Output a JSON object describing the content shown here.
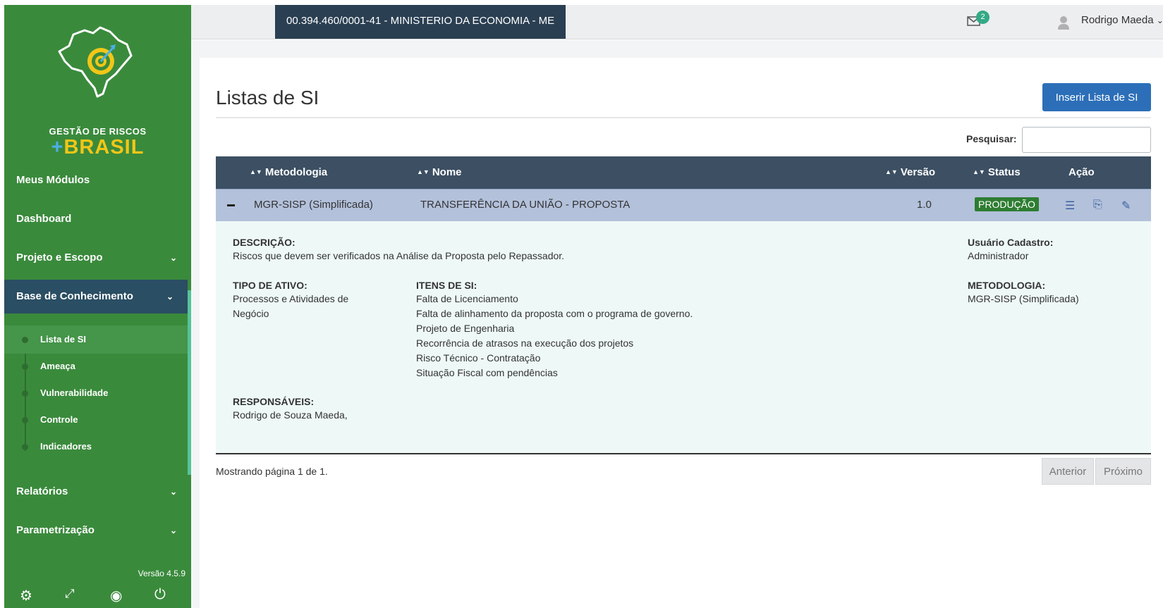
{
  "org": "00.394.460/0001-41 - MINISTERIO DA ECONOMIA - ME",
  "notifications": {
    "count": "2"
  },
  "user": {
    "name": "Rodrigo Maeda"
  },
  "logo": {
    "line1": "GESTÃO DE RISCOS",
    "plus": "+",
    "line2": "BRASIL"
  },
  "sidebar": {
    "items": [
      {
        "label": "Meus Módulos"
      },
      {
        "label": "Dashboard"
      },
      {
        "label": "Projeto e Escopo"
      },
      {
        "label": "Base de Conhecimento"
      },
      {
        "label": "Relatórios"
      },
      {
        "label": "Parametrização"
      }
    ],
    "subitems": [
      {
        "label": "Lista de SI"
      },
      {
        "label": "Ameaça"
      },
      {
        "label": "Vulnerabilidade"
      },
      {
        "label": "Controle"
      },
      {
        "label": "Indicadores"
      }
    ],
    "version": "Versão 4.5.9",
    "tools": [
      "gear-icon",
      "fullscreen-icon",
      "hide-icon",
      "power-icon"
    ]
  },
  "page": {
    "title": "Listas de SI",
    "insert_button": "Inserir Lista de SI",
    "search_label": "Pesquisar:",
    "search_value": ""
  },
  "table": {
    "headers": {
      "metodologia": "Metodologia",
      "nome": "Nome",
      "versao": "Versão",
      "status": "Status",
      "acao": "Ação"
    },
    "row": {
      "metodologia": "MGR-SISP (Simplificada)",
      "nome": "TRANSFERÊNCIA DA UNIÃO - PROPOSTA",
      "versao": "1.0",
      "status": "PRODUÇÃO"
    }
  },
  "detail": {
    "descricao_label": "DESCRIÇÃO:",
    "descricao": "Riscos que devem ser verificados na Análise da Proposta pelo Repassador.",
    "usuario_label": "Usuário Cadastro:",
    "usuario": "Administrador",
    "tipo_label": "TIPO DE ATIVO:",
    "tipo_lines": [
      "Processos e Atividades de",
      "Negócio"
    ],
    "itens_label": "ITENS DE SI:",
    "itens": [
      "Falta de Licenciamento",
      "Falta de alinhamento da proposta com o programa de governo.",
      "Projeto de Engenharia",
      "Recorrência de atrasos na execução dos projetos",
      "Risco Técnico - Contratação",
      "Situação Fiscal com pendências"
    ],
    "metodologia_label": "METODOLOGIA:",
    "metodologia": "MGR-SISP (Simplificada)",
    "responsaveis_label": "RESPONSÁVEIS:",
    "responsaveis": "Rodrigo de Souza Maeda,"
  },
  "pagination": {
    "info": "Mostrando página 1 de 1.",
    "prev": "Anterior",
    "next": "Próximo"
  }
}
